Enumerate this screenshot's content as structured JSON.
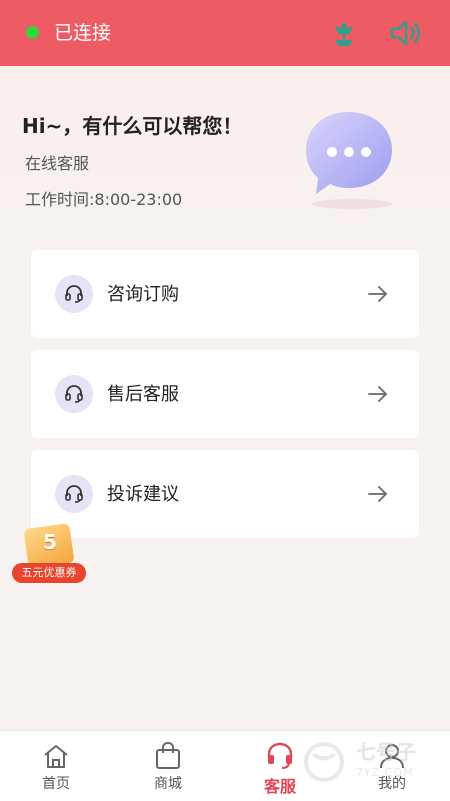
{
  "status": {
    "text": "已连接",
    "color": "#35d23f"
  },
  "header": {
    "icons": [
      "flower-icon",
      "speaker-icon"
    ],
    "background": "#ef5b64"
  },
  "hero": {
    "greeting": "Hi~，有什么可以帮您！",
    "subtitle": "在线客服",
    "hours": "工作时间:8:00-23:00"
  },
  "services": [
    {
      "label": "咨询订购",
      "icon": "headset-icon"
    },
    {
      "label": "售后客服",
      "icon": "headset-icon"
    },
    {
      "label": "投诉建议",
      "icon": "headset-icon"
    }
  ],
  "coupon": {
    "number": "5",
    "label": "五元优惠券"
  },
  "tabs": [
    {
      "label": "首页",
      "icon": "home-icon",
      "active": false
    },
    {
      "label": "商城",
      "icon": "shopping-bag-icon",
      "active": false
    },
    {
      "label": "客服",
      "icon": "headset-icon",
      "active": true
    },
    {
      "label": "我的",
      "icon": "user-icon",
      "active": false
    }
  ],
  "watermark": {
    "text": "七号子",
    "sub": "7YZ.COM"
  }
}
